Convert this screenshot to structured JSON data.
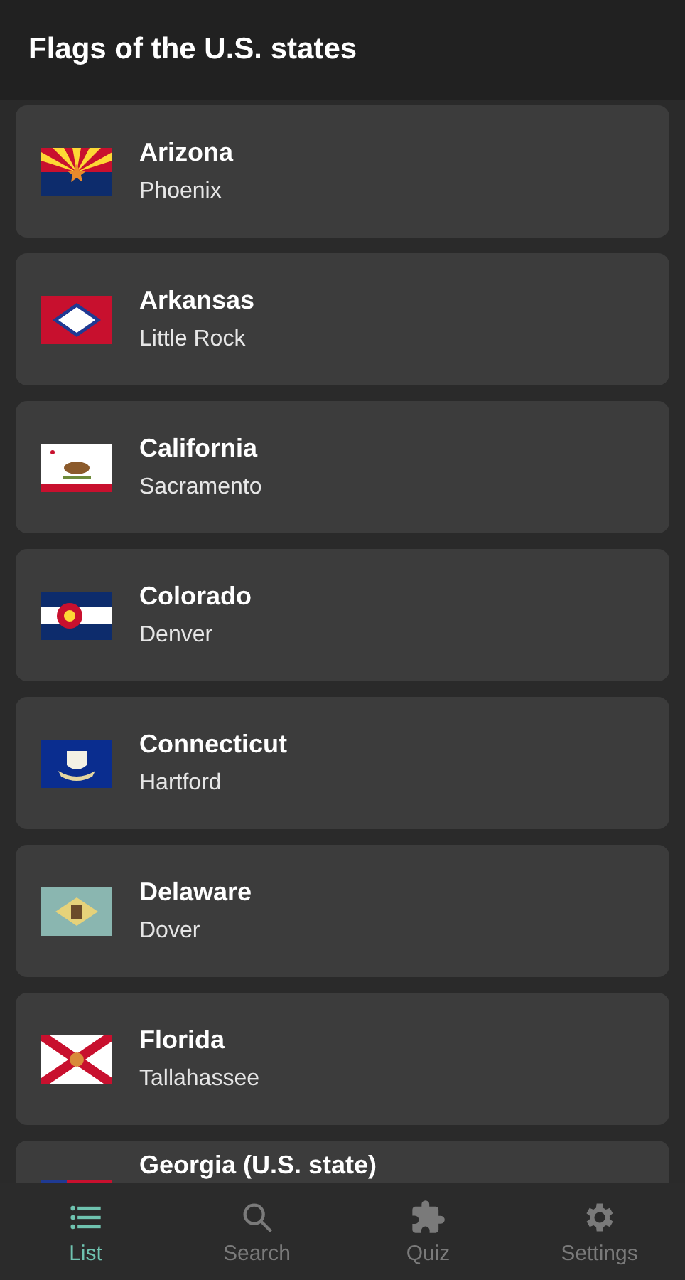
{
  "app_bar": {
    "title": "Flags of the U.S. states"
  },
  "states": [
    {
      "name": "Arizona",
      "capital": "Phoenix"
    },
    {
      "name": "Arkansas",
      "capital": "Little Rock"
    },
    {
      "name": "California",
      "capital": "Sacramento"
    },
    {
      "name": "Colorado",
      "capital": "Denver"
    },
    {
      "name": "Connecticut",
      "capital": "Hartford"
    },
    {
      "name": "Delaware",
      "capital": "Dover"
    },
    {
      "name": "Florida",
      "capital": "Tallahassee"
    },
    {
      "name": "Georgia (U.S. state)"
    }
  ],
  "bottom_nav": [
    {
      "label": "List",
      "selected": true
    },
    {
      "label": "Search",
      "selected": false
    },
    {
      "label": "Quiz",
      "selected": false
    },
    {
      "label": "Settings",
      "selected": false
    }
  ]
}
